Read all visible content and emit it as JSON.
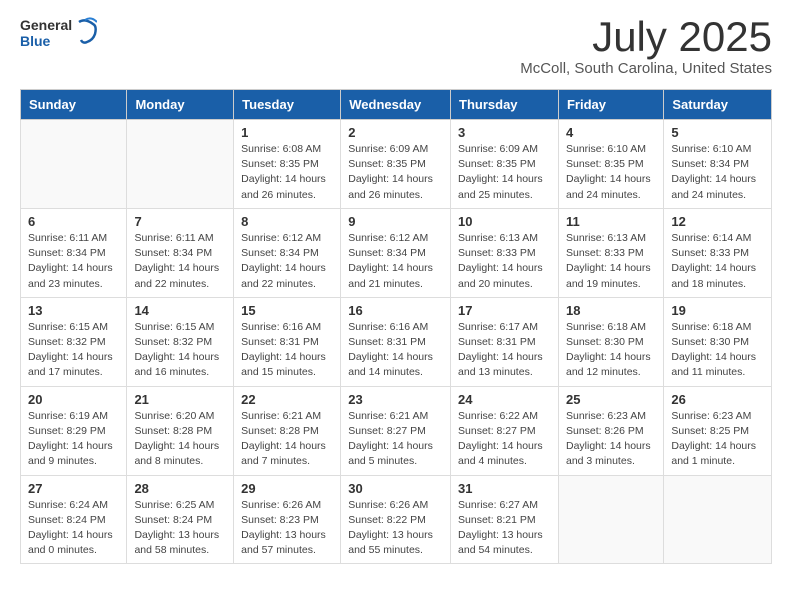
{
  "header": {
    "logo_general": "General",
    "logo_blue": "Blue",
    "month": "July 2025",
    "location": "McColl, South Carolina, United States"
  },
  "days_of_week": [
    "Sunday",
    "Monday",
    "Tuesday",
    "Wednesday",
    "Thursday",
    "Friday",
    "Saturday"
  ],
  "weeks": [
    [
      {
        "day": "",
        "info": ""
      },
      {
        "day": "",
        "info": ""
      },
      {
        "day": "1",
        "info": "Sunrise: 6:08 AM\nSunset: 8:35 PM\nDaylight: 14 hours and 26 minutes."
      },
      {
        "day": "2",
        "info": "Sunrise: 6:09 AM\nSunset: 8:35 PM\nDaylight: 14 hours and 26 minutes."
      },
      {
        "day": "3",
        "info": "Sunrise: 6:09 AM\nSunset: 8:35 PM\nDaylight: 14 hours and 25 minutes."
      },
      {
        "day": "4",
        "info": "Sunrise: 6:10 AM\nSunset: 8:35 PM\nDaylight: 14 hours and 24 minutes."
      },
      {
        "day": "5",
        "info": "Sunrise: 6:10 AM\nSunset: 8:34 PM\nDaylight: 14 hours and 24 minutes."
      }
    ],
    [
      {
        "day": "6",
        "info": "Sunrise: 6:11 AM\nSunset: 8:34 PM\nDaylight: 14 hours and 23 minutes."
      },
      {
        "day": "7",
        "info": "Sunrise: 6:11 AM\nSunset: 8:34 PM\nDaylight: 14 hours and 22 minutes."
      },
      {
        "day": "8",
        "info": "Sunrise: 6:12 AM\nSunset: 8:34 PM\nDaylight: 14 hours and 22 minutes."
      },
      {
        "day": "9",
        "info": "Sunrise: 6:12 AM\nSunset: 8:34 PM\nDaylight: 14 hours and 21 minutes."
      },
      {
        "day": "10",
        "info": "Sunrise: 6:13 AM\nSunset: 8:33 PM\nDaylight: 14 hours and 20 minutes."
      },
      {
        "day": "11",
        "info": "Sunrise: 6:13 AM\nSunset: 8:33 PM\nDaylight: 14 hours and 19 minutes."
      },
      {
        "day": "12",
        "info": "Sunrise: 6:14 AM\nSunset: 8:33 PM\nDaylight: 14 hours and 18 minutes."
      }
    ],
    [
      {
        "day": "13",
        "info": "Sunrise: 6:15 AM\nSunset: 8:32 PM\nDaylight: 14 hours and 17 minutes."
      },
      {
        "day": "14",
        "info": "Sunrise: 6:15 AM\nSunset: 8:32 PM\nDaylight: 14 hours and 16 minutes."
      },
      {
        "day": "15",
        "info": "Sunrise: 6:16 AM\nSunset: 8:31 PM\nDaylight: 14 hours and 15 minutes."
      },
      {
        "day": "16",
        "info": "Sunrise: 6:16 AM\nSunset: 8:31 PM\nDaylight: 14 hours and 14 minutes."
      },
      {
        "day": "17",
        "info": "Sunrise: 6:17 AM\nSunset: 8:31 PM\nDaylight: 14 hours and 13 minutes."
      },
      {
        "day": "18",
        "info": "Sunrise: 6:18 AM\nSunset: 8:30 PM\nDaylight: 14 hours and 12 minutes."
      },
      {
        "day": "19",
        "info": "Sunrise: 6:18 AM\nSunset: 8:30 PM\nDaylight: 14 hours and 11 minutes."
      }
    ],
    [
      {
        "day": "20",
        "info": "Sunrise: 6:19 AM\nSunset: 8:29 PM\nDaylight: 14 hours and 9 minutes."
      },
      {
        "day": "21",
        "info": "Sunrise: 6:20 AM\nSunset: 8:28 PM\nDaylight: 14 hours and 8 minutes."
      },
      {
        "day": "22",
        "info": "Sunrise: 6:21 AM\nSunset: 8:28 PM\nDaylight: 14 hours and 7 minutes."
      },
      {
        "day": "23",
        "info": "Sunrise: 6:21 AM\nSunset: 8:27 PM\nDaylight: 14 hours and 5 minutes."
      },
      {
        "day": "24",
        "info": "Sunrise: 6:22 AM\nSunset: 8:27 PM\nDaylight: 14 hours and 4 minutes."
      },
      {
        "day": "25",
        "info": "Sunrise: 6:23 AM\nSunset: 8:26 PM\nDaylight: 14 hours and 3 minutes."
      },
      {
        "day": "26",
        "info": "Sunrise: 6:23 AM\nSunset: 8:25 PM\nDaylight: 14 hours and 1 minute."
      }
    ],
    [
      {
        "day": "27",
        "info": "Sunrise: 6:24 AM\nSunset: 8:24 PM\nDaylight: 14 hours and 0 minutes."
      },
      {
        "day": "28",
        "info": "Sunrise: 6:25 AM\nSunset: 8:24 PM\nDaylight: 13 hours and 58 minutes."
      },
      {
        "day": "29",
        "info": "Sunrise: 6:26 AM\nSunset: 8:23 PM\nDaylight: 13 hours and 57 minutes."
      },
      {
        "day": "30",
        "info": "Sunrise: 6:26 AM\nSunset: 8:22 PM\nDaylight: 13 hours and 55 minutes."
      },
      {
        "day": "31",
        "info": "Sunrise: 6:27 AM\nSunset: 8:21 PM\nDaylight: 13 hours and 54 minutes."
      },
      {
        "day": "",
        "info": ""
      },
      {
        "day": "",
        "info": ""
      }
    ]
  ]
}
